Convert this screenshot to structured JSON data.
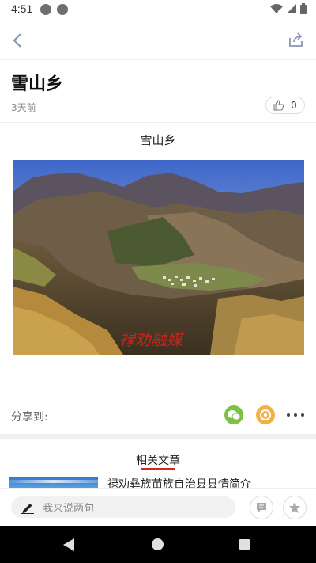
{
  "status_bar": {
    "time": "4:51"
  },
  "article": {
    "title": "雪山乡",
    "time_ago": "3天前",
    "like_count": "0",
    "heading": "雪山乡",
    "image_watermark": "禄劝融媒"
  },
  "share": {
    "label": "分享到:"
  },
  "related": {
    "title": "相关文章",
    "items": [
      {
        "title": "禄劝彝族苗族自治县县情简介"
      }
    ]
  },
  "comment": {
    "placeholder": "我来说两句"
  },
  "colors": {
    "accent": "#d9241a",
    "wechat": "#7bc142",
    "moments": "#f2b04a",
    "nav_icon": "#8a95b8"
  }
}
